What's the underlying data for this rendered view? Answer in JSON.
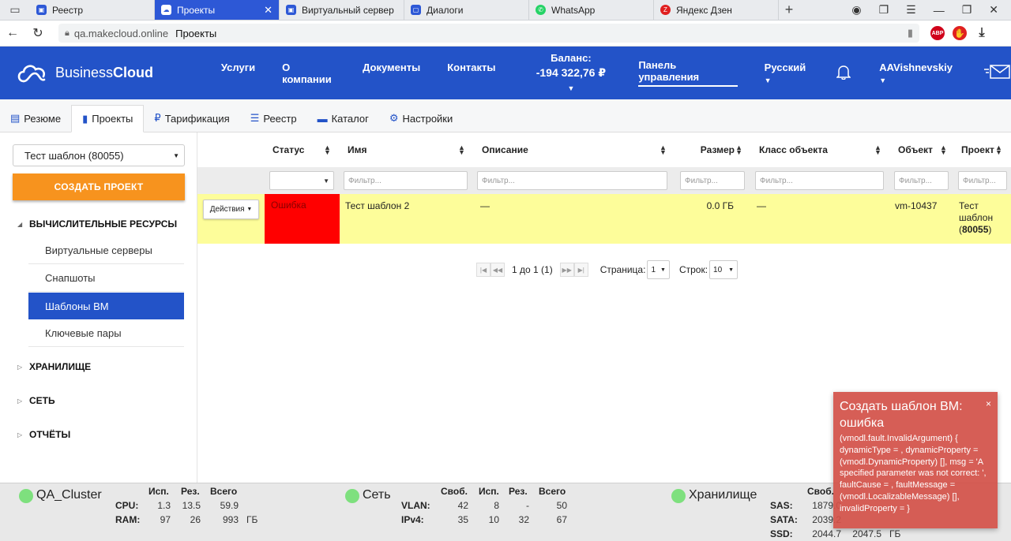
{
  "browser": {
    "tabs": [
      {
        "label": "Реестр",
        "fav_color": "#2d58d6",
        "fav_glyph": "▣"
      },
      {
        "label": "Проекты",
        "fav_color": "#ffffff",
        "fav_glyph": "☁",
        "active": true
      },
      {
        "label": "Виртуальный сервер",
        "fav_color": "#2d58d6",
        "fav_glyph": "▣"
      },
      {
        "label": "Диалоги",
        "fav_color": "#2d58d6",
        "fav_glyph": "▢"
      },
      {
        "label": "WhatsApp",
        "fav_color": "#25d366",
        "fav_glyph": "●"
      },
      {
        "label": "Яндекс Дзен",
        "fav_color": "#e02020",
        "fav_glyph": "Z"
      }
    ],
    "url_host": "qa.makecloud.online",
    "page_title": "Проекты"
  },
  "header": {
    "logo_light": "Business",
    "logo_bold": "Cloud",
    "menu": [
      "Услуги",
      "О компании",
      "Документы",
      "Контакты"
    ],
    "balance_label": "Баланс:",
    "balance_value": "-194 322,76 ₽",
    "panel_link": "Панель управления",
    "language": "Русский",
    "user": "AAVishnevskiy"
  },
  "subtabs": [
    {
      "label": "Резюме",
      "icon": "list-icon"
    },
    {
      "label": "Проекты",
      "icon": "bar-chart-icon",
      "active": true
    },
    {
      "label": "Тарификация",
      "icon": "ruble-icon"
    },
    {
      "label": "Реестр",
      "icon": "list-icon"
    },
    {
      "label": "Каталог",
      "icon": "folder-icon"
    },
    {
      "label": "Настройки",
      "icon": "gear-icon"
    }
  ],
  "sidebar": {
    "project_select": "Тест шаблон (80055)",
    "create_button": "СОЗДАТЬ ПРОЕКТ",
    "sections": {
      "compute": "ВЫЧИСЛИТЕЛЬНЫЕ РЕСУРСЫ",
      "storage": "ХРАНИЛИЩЕ",
      "network": "СЕТЬ",
      "reports": "ОТЧЁТЫ"
    },
    "compute_items": [
      "Виртуальные серверы",
      "Снапшоты",
      "Шаблоны ВМ",
      "Ключевые пары"
    ]
  },
  "table": {
    "columns": {
      "status": "Статус",
      "name": "Имя",
      "description": "Описание",
      "size": "Размер",
      "object_class": "Класс объекта",
      "object": "Объект",
      "project": "Проект"
    },
    "filter_placeholder": "Фильтр...",
    "row": {
      "actions": "Действия",
      "status": "Ошибка",
      "name": "Тест шаблон 2",
      "description": "—",
      "size": "0.0 ГБ",
      "object_class": "—",
      "object": "vm-10437",
      "project_line1": "Тест",
      "project_line2": "шаблон",
      "project_line3_pre": "(",
      "project_line3_bold": "80055",
      "project_line3_post": ")"
    }
  },
  "pager": {
    "range": "1 до 1 (1)",
    "page_label": "Страница:",
    "page_value": "1",
    "rows_label": "Строк:",
    "rows_value": "10"
  },
  "footer": {
    "cluster": {
      "title": "QA_Cluster",
      "headers": [
        "Исп.",
        "Рез.",
        "Всего"
      ],
      "rows": [
        {
          "label": "CPU:",
          "values": [
            "1.3",
            "13.5",
            "59.9"
          ],
          "unit": ""
        },
        {
          "label": "RAM:",
          "values": [
            "97",
            "26",
            "993"
          ],
          "unit": "ГБ"
        }
      ]
    },
    "network": {
      "title": "Сеть",
      "headers": [
        "Своб.",
        "Исп.",
        "Рез.",
        "Всего"
      ],
      "rows": [
        {
          "label": "VLAN:",
          "values": [
            "42",
            "8",
            "-",
            "50"
          ]
        },
        {
          "label": "IPv4:",
          "values": [
            "35",
            "10",
            "32",
            "67"
          ]
        }
      ]
    },
    "storage": {
      "title": "Хранилище",
      "headers": [
        "Своб."
      ],
      "rows": [
        {
          "label": "SAS:",
          "values": [
            "1879.0"
          ]
        },
        {
          "label": "SATA:",
          "values": [
            "2039.2"
          ]
        },
        {
          "label": "SSD:",
          "values": [
            "2044.7",
            "2047.5"
          ],
          "unit": "ГБ"
        }
      ]
    }
  },
  "toast": {
    "title": "Создать шаблон ВМ: ошибка",
    "message": "(vmodl.fault.InvalidArgument) { dynamicType = , dynamicProperty = (vmodl.DynamicProperty) [], msg = 'A specified parameter was not correct: ', faultCause = , faultMessage = (vmodl.LocalizableMessage) [], invalidProperty = }",
    "close": "×"
  },
  "colors": {
    "brand": "#2353c8",
    "accent_orange": "#f7931e",
    "row_highlight": "#fdfd9a",
    "error_red": "#ff0000",
    "toast_bg": "#d25048"
  }
}
